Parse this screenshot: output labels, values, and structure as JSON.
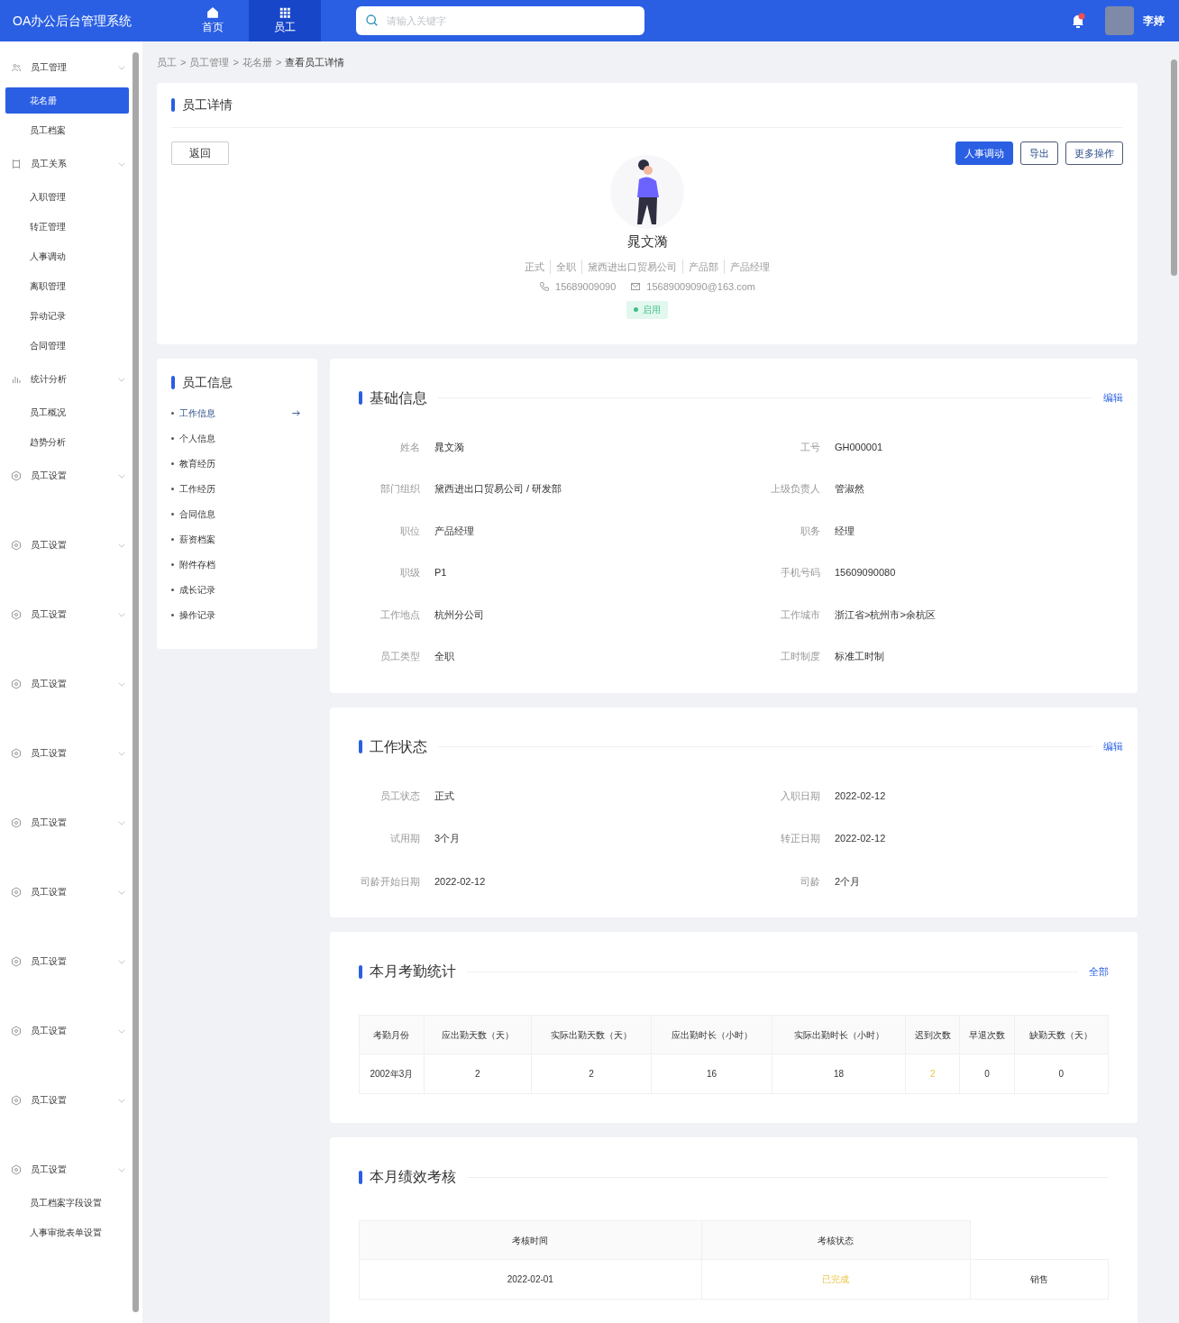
{
  "header": {
    "app_title": "OA办公后台管理系统",
    "nav": [
      {
        "label": "首页",
        "selected": false
      },
      {
        "label": "员工",
        "selected": true
      }
    ],
    "search": {
      "placeholder": "请输入关键字"
    },
    "notification": {
      "unread": true
    },
    "user": {
      "name": "李婷"
    }
  },
  "sidebar": {
    "groups": [
      {
        "label": "员工管理",
        "children": [
          {
            "label": "花名册",
            "selected": true
          },
          {
            "label": "员工档案",
            "selected": false
          }
        ]
      },
      {
        "label": "员工关系",
        "children": [
          {
            "label": "入职管理",
            "selected": false
          },
          {
            "label": "转正管理",
            "selected": false
          },
          {
            "label": "人事调动",
            "selected": false
          },
          {
            "label": "离职管理",
            "selected": false
          },
          {
            "label": "异动记录",
            "selected": false
          },
          {
            "label": "合同管理",
            "selected": false
          }
        ]
      },
      {
        "label": "统计分析",
        "children": [
          {
            "label": "员工概况",
            "selected": false
          },
          {
            "label": "趋势分析",
            "selected": false
          }
        ]
      },
      {
        "label": "员工设置"
      },
      {
        "label": "员工设置"
      },
      {
        "label": "员工设置"
      },
      {
        "label": "员工设置"
      },
      {
        "label": "员工设置"
      },
      {
        "label": "员工设置"
      },
      {
        "label": "员工设置"
      },
      {
        "label": "员工设置"
      },
      {
        "label": "员工设置"
      },
      {
        "label": "员工设置"
      },
      {
        "label": "员工设置",
        "children": [
          {
            "label": "员工档案字段设置",
            "selected": false
          },
          {
            "label": "人事审批表单设置",
            "selected": false
          }
        ]
      }
    ]
  },
  "breadcrumb": [
    "员工",
    ">",
    "员工管理",
    ">",
    "花名册",
    ">",
    "查看员工详情"
  ],
  "detail_card": {
    "title": "员工详情",
    "back_button": "返回",
    "actions": [
      {
        "label": "人事调动",
        "primary": true
      },
      {
        "label": "导出",
        "primary": false
      },
      {
        "label": "更多操作",
        "primary": false
      }
    ],
    "profile": {
      "name": "晁文漪",
      "tags": [
        "正式",
        "全职",
        "黛西进出口贸易公司",
        "产品部",
        "产品经理"
      ],
      "phone": "15689009090",
      "email": "15689009090@163.com",
      "status": {
        "label": "启用",
        "enabled": true
      }
    }
  },
  "info_nav": {
    "title": "员工信息",
    "items": [
      {
        "label": "工作信息",
        "selected": true
      },
      {
        "label": "个人信息",
        "selected": false
      },
      {
        "label": "教育经历",
        "selected": false
      },
      {
        "label": "工作经历",
        "selected": false
      },
      {
        "label": "合同信息",
        "selected": false
      },
      {
        "label": "薪资档案",
        "selected": false
      },
      {
        "label": "附件存档",
        "selected": false
      },
      {
        "label": "成长记录",
        "selected": false
      },
      {
        "label": "操作记录",
        "selected": false
      }
    ]
  },
  "basic_info": {
    "title": "基础信息",
    "link": "编辑",
    "fields": [
      {
        "label": "姓名",
        "value": "晁文漪"
      },
      {
        "label": "工号",
        "value": "GH000001"
      },
      {
        "label": "部门组织",
        "value": "黛西进出口贸易公司 / 研发部"
      },
      {
        "label": "上级负责人",
        "value": "管淑然"
      },
      {
        "label": "职位",
        "value": "产品经理"
      },
      {
        "label": "职务",
        "value": "经理"
      },
      {
        "label": "职级",
        "value": "P1"
      },
      {
        "label": "手机号码",
        "value": "15609090080"
      },
      {
        "label": "工作地点",
        "value": "杭州分公司"
      },
      {
        "label": "工作城市",
        "value": "浙江省>杭州市>余杭区"
      },
      {
        "label": "员工类型",
        "value": "全职"
      },
      {
        "label": "工时制度",
        "value": "标准工时制"
      }
    ]
  },
  "work_status": {
    "title": "工作状态",
    "link": "编辑",
    "fields": [
      {
        "label": "员工状态",
        "value": "正式"
      },
      {
        "label": "入职日期",
        "value": "2022-02-12"
      },
      {
        "label": "试用期",
        "value": "3个月"
      },
      {
        "label": "转正日期",
        "value": "2022-02-12"
      },
      {
        "label": "司龄开始日期",
        "value": "2022-02-12"
      },
      {
        "label": "司龄",
        "value": "2个月"
      }
    ]
  },
  "attendance": {
    "title": "本月考勤统计",
    "link": "全部",
    "columns": [
      "考勤月份",
      "应出勤天数（天）",
      "实际出勤天数（天）",
      "应出勤时长（小时）",
      "实际出勤时长（小时）",
      "迟到次数",
      "早退次数",
      "缺勤天数（天）"
    ],
    "rows": [
      [
        {
          "text": "2002年3月",
          "highlight": false
        },
        {
          "text": "2",
          "highlight": false
        },
        {
          "text": "2",
          "highlight": false
        },
        {
          "text": "16",
          "highlight": false
        },
        {
          "text": "18",
          "highlight": false
        },
        {
          "text": "2",
          "highlight": true
        },
        {
          "text": "0",
          "highlight": false
        },
        {
          "text": "0",
          "highlight": false
        }
      ]
    ]
  },
  "performance": {
    "title": "本月绩效考核",
    "columns": [
      "考核时间",
      "考核状态"
    ],
    "rows": [
      [
        {
          "text": "2022-02-01",
          "highlight": false
        },
        {
          "text": "已完成",
          "highlight": true
        },
        {
          "text": "销售",
          "highlight": false
        }
      ]
    ]
  }
}
